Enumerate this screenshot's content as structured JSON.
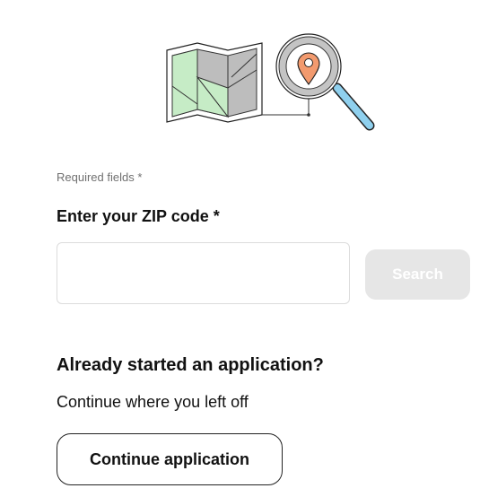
{
  "illustration": {
    "icon": "map-magnifier-icon",
    "colors": {
      "map_green": "#c6ecc6",
      "map_gray": "#bdbdbd",
      "pin": "#f29a6e",
      "handle": "#8fd0ee"
    }
  },
  "form": {
    "required_note": "Required fields *",
    "zip_label": "Enter your ZIP code *",
    "zip_value": "",
    "zip_placeholder": "",
    "search_label": "Search"
  },
  "resume": {
    "heading": "Already started an application?",
    "subtext": "Continue where you left off",
    "button_label": "Continue application"
  },
  "colors": {
    "search_button_disabled_bg": "#e6e6e6",
    "input_border": "#dcdcdc",
    "button_border": "#222222"
  }
}
